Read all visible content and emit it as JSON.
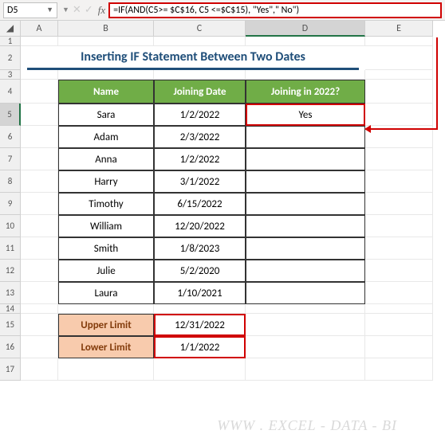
{
  "name_box": "D5",
  "formula": "=IF(AND(C5>= $C$16, C5 <=$C$15), \"Yes\",\" No\")",
  "columns": [
    "",
    "A",
    "B",
    "C",
    "D",
    "E"
  ],
  "title": "Inserting IF Statement Between Two Dates",
  "table": {
    "headers": [
      "Name",
      "Joining Date",
      "Joining in 2022?"
    ],
    "rows": [
      {
        "name": "Sara",
        "date": "1/2/2022",
        "result": "Yes"
      },
      {
        "name": "Adam",
        "date": "2/3/2022",
        "result": ""
      },
      {
        "name": "Anna",
        "date": "1/2/2022",
        "result": ""
      },
      {
        "name": "Harry",
        "date": "3/1/2022",
        "result": ""
      },
      {
        "name": "Timothy",
        "date": "6/15/2022",
        "result": ""
      },
      {
        "name": "William",
        "date": "12/20/2022",
        "result": ""
      },
      {
        "name": "Smith",
        "date": "1/8/2023",
        "result": ""
      },
      {
        "name": "Julie",
        "date": "5/2/2020",
        "result": ""
      },
      {
        "name": "Laura",
        "date": "1/10/2021",
        "result": ""
      }
    ]
  },
  "limits": {
    "upper_label": "Upper Limit",
    "upper_value": "12/31/2022",
    "lower_label": "Lower Limit",
    "lower_value": "1/1/2022"
  },
  "row_numbers": [
    "1",
    "2",
    "3",
    "4",
    "5",
    "6",
    "7",
    "8",
    "9",
    "10",
    "11",
    "12",
    "13",
    "14",
    "15",
    "16",
    "17"
  ],
  "watermark": "WWW . EXCEL - DATA - BI",
  "fx": "fx"
}
